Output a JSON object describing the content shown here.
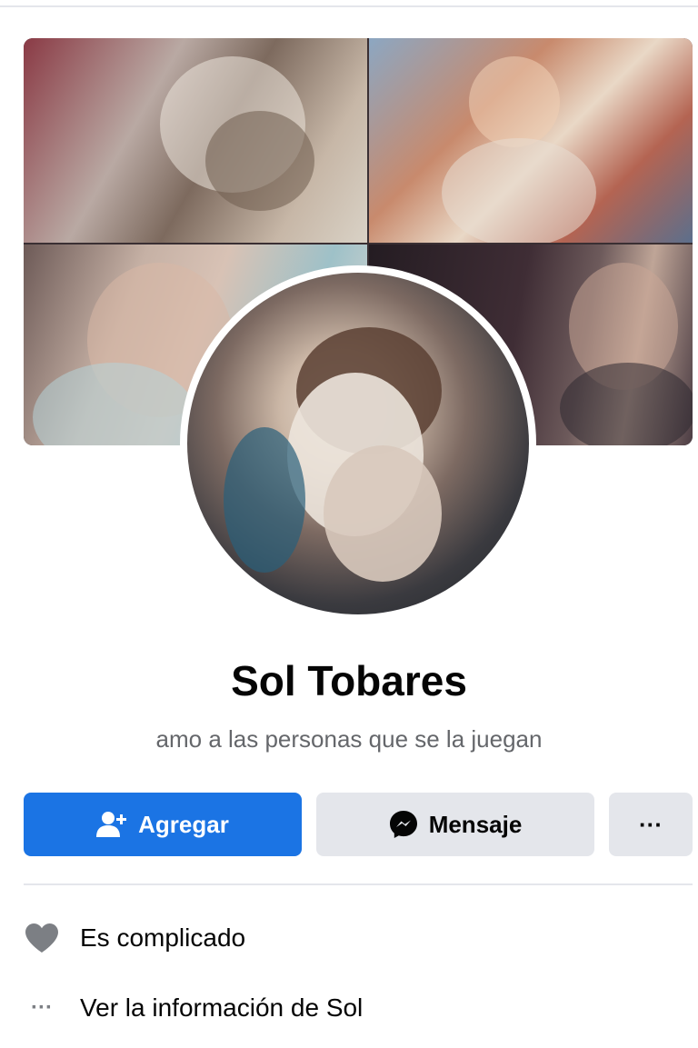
{
  "profile": {
    "name": "Sol Tobares",
    "bio": "amo a las personas que se la juegan"
  },
  "actions": {
    "add_label": "Agregar",
    "message_label": "Mensaje",
    "more_label": "···"
  },
  "details": {
    "relationship": "Es complicado",
    "see_info": "Ver la información de Sol",
    "see_info_icon_text": "···"
  },
  "icons": {
    "add": "add-friend-icon",
    "message": "messenger-icon",
    "relationship": "heart-icon",
    "more": "more-dots-icon"
  },
  "colors": {
    "primary": "#1b74e4",
    "secondary_button": "#e4e6eb",
    "text": "#050505",
    "muted_text": "#65676b"
  }
}
